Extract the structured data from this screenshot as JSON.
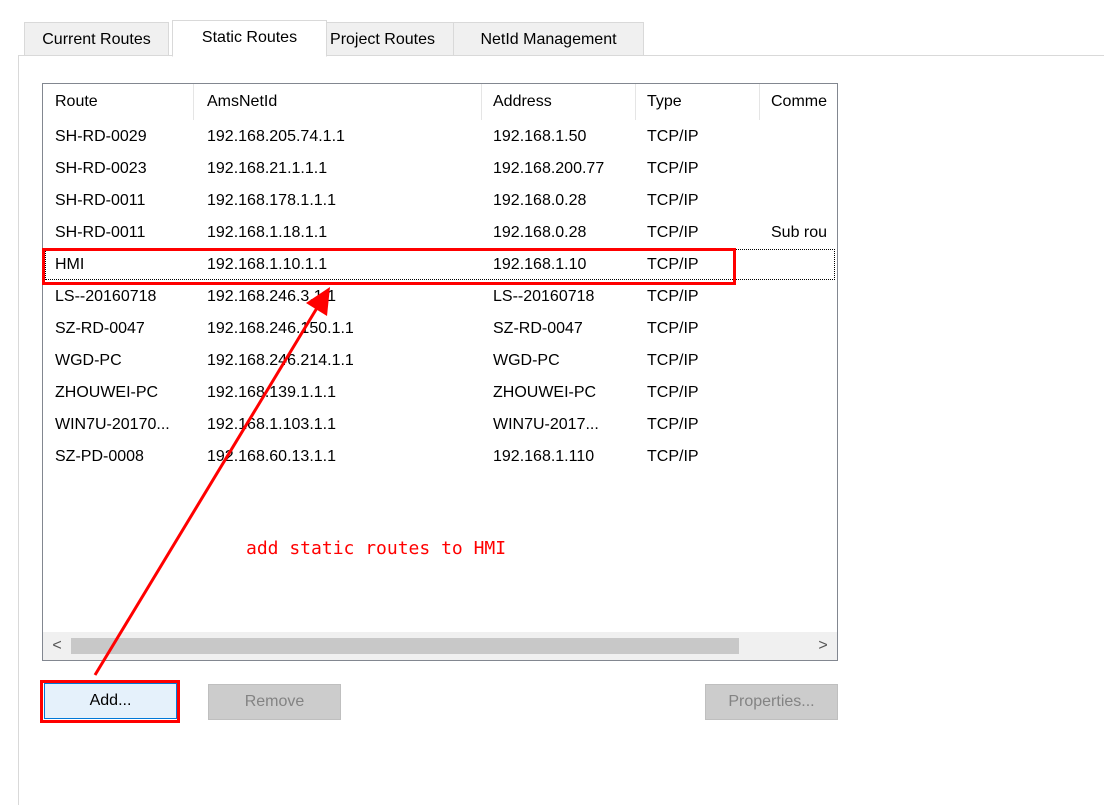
{
  "tabs": [
    {
      "label": "Current Routes",
      "active": false
    },
    {
      "label": "Static Routes",
      "active": true
    },
    {
      "label": "Project Routes",
      "active": false
    },
    {
      "label": "NetId Management",
      "active": false
    }
  ],
  "table": {
    "columns": [
      "Route",
      "AmsNetId",
      "Address",
      "Type",
      "Comme"
    ],
    "rows": [
      [
        "SH-RD-0029",
        "192.168.205.74.1.1",
        "192.168.1.50",
        "TCP/IP",
        ""
      ],
      [
        "SH-RD-0023",
        "192.168.21.1.1.1",
        "192.168.200.77",
        "TCP/IP",
        ""
      ],
      [
        "SH-RD-0011",
        "192.168.178.1.1.1",
        "192.168.0.28",
        "TCP/IP",
        ""
      ],
      [
        "SH-RD-0011",
        "192.168.1.18.1.1",
        "192.168.0.28",
        "TCP/IP",
        "Sub rou"
      ],
      [
        "HMI",
        "192.168.1.10.1.1",
        "192.168.1.10",
        "TCP/IP",
        ""
      ],
      [
        "LS--20160718",
        "192.168.246.3.1.1",
        "LS--20160718",
        "TCP/IP",
        ""
      ],
      [
        "SZ-RD-0047",
        "192.168.246.150.1.1",
        "SZ-RD-0047",
        "TCP/IP",
        ""
      ],
      [
        "WGD-PC",
        "192.168.246.214.1.1",
        "WGD-PC",
        "TCP/IP",
        ""
      ],
      [
        "ZHOUWEI-PC",
        "192.168.139.1.1.1",
        "ZHOUWEI-PC",
        "TCP/IP",
        ""
      ],
      [
        "WIN7U-20170...",
        "192.168.1.103.1.1",
        "WIN7U-2017...",
        "TCP/IP",
        ""
      ],
      [
        "SZ-PD-0008",
        "192.168.60.13.1.1",
        "192.168.1.110",
        "TCP/IP",
        ""
      ]
    ],
    "focused_row": 4
  },
  "scrollbar": {
    "left_arrow": "<",
    "right_arrow": ">"
  },
  "buttons": {
    "add": "Add...",
    "remove": "Remove",
    "properties": "Properties..."
  },
  "annotation": {
    "text": "add static routes to HMI"
  },
  "colors": {
    "annotation": "#ff0000",
    "disabled_button": "#cccccc"
  }
}
